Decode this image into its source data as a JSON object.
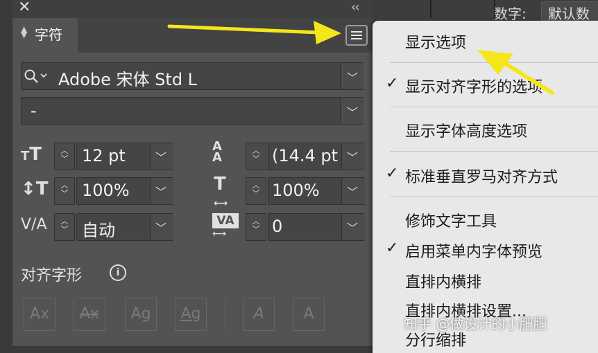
{
  "background": {
    "label": "数字:",
    "value": "默认数"
  },
  "panel": {
    "close_glyph": "✕",
    "collapse_glyph": "‹‹",
    "tab_label": "字符",
    "font_family": "Adobe 宋体 Std L",
    "font_style": "-",
    "font_size": "12 pt",
    "leading": "(14.4 pt",
    "vertical_scale": "100%",
    "horizontal_scale": "100%",
    "kerning": "自动",
    "tracking": "0",
    "align_glyphs_label": "对齐字形",
    "info_glyph": "i",
    "glyph_buttons": [
      "Ax",
      "Ax",
      "Ag",
      "Ag",
      "A",
      "A"
    ]
  },
  "menu": {
    "items": [
      {
        "label": "显示选项",
        "checked": false
      },
      {
        "label": "显示对齐字形的选项",
        "checked": true
      },
      {
        "label": "显示字体高度选项",
        "checked": false
      },
      {
        "label": "标准垂直罗马对齐方式",
        "checked": true
      },
      {
        "label": "修饰文字工具",
        "checked": false
      },
      {
        "label": "启用菜单内字体预览",
        "checked": true
      },
      {
        "label": "直排内横排",
        "checked": false
      },
      {
        "label": "直排内横排设置...",
        "checked": false
      },
      {
        "label": "分行缩排",
        "checked": false
      }
    ],
    "check_glyph": "✓"
  },
  "watermark": "知乎 @做设计的小肥肥",
  "colors": {
    "panel": "#535353",
    "menu": "#e8e8e8",
    "arrow": "#f5e61a"
  }
}
